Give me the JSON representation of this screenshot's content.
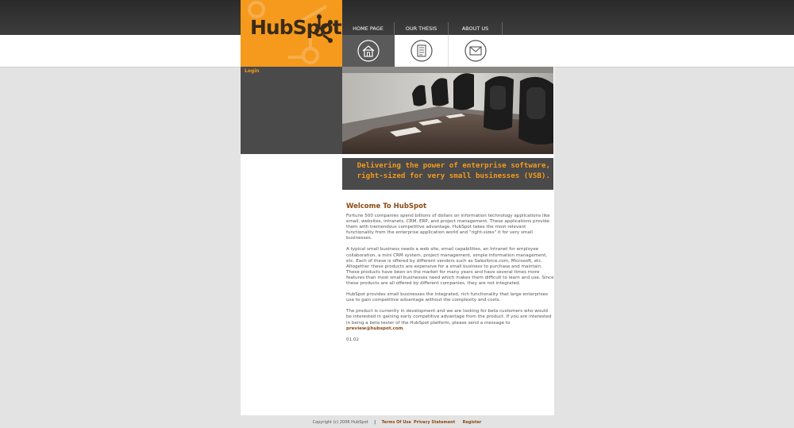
{
  "logo": {
    "text": "HubSpot"
  },
  "nav": {
    "home": "HOME PAGE",
    "thesis": "OUR THESIS",
    "about": "ABOUT US"
  },
  "nav_icons": [
    "home-icon",
    "document-icon",
    "envelope-icon"
  ],
  "sidebar": {
    "login": "Login"
  },
  "tagline": {
    "line1": "Delivering the power of enterprise software,",
    "line2": "right-sized for very small businesses (VSB)."
  },
  "content": {
    "title": "Welcome To HubSpot",
    "p1": "Fortune 500 companies spend billions of dollars on information technology applications like email, websites, intranets, CRM, ERP, and project management. These applications provide them with tremendous competitive advantage. HubSpot takes the most relevant functionality from the enterprise application world and \"right-sizes\" it for very small businesses.",
    "p2": "A typical small business needs a web site, email capabilities, an Intranet for employee collaboration, a mini CRM system, project management, simple information management, etc. Each of these is offered by different vendors such as Salesforce.com, Microsoft, etc. Altogether these products are expensive for a small business to purchase and maintain. These products have been on the market for many years and have several times more features than most small businesses need which makes them difficult to learn and use. Since these products are all offered by different companies, they are not integrated.",
    "p3": "HubSpot provides small businesses the integrated, rich functionality that large enterprises use to gain competitive advantage without the complexity and costs.",
    "p4": "The product is currently in development and we are looking for beta customers who would be interested in gaining early competitive advantage from the product. If you are interested in being a beta tester of the HubSpot platform, please send a message to",
    "email": "preview@hubspot.com",
    "p4_end": ".",
    "version": "01.02"
  },
  "footer": {
    "copyright": "Copyright (c) 2006 HubSpot",
    "separator": "|",
    "terms": "Terms Of Use",
    "privacy": "Privacy Statement",
    "register": "Register"
  },
  "colors": {
    "accent": "#f59a1d",
    "dark_panel": "#4a4a4a",
    "heading": "#8a4a14",
    "background": "#e3e3e3"
  }
}
